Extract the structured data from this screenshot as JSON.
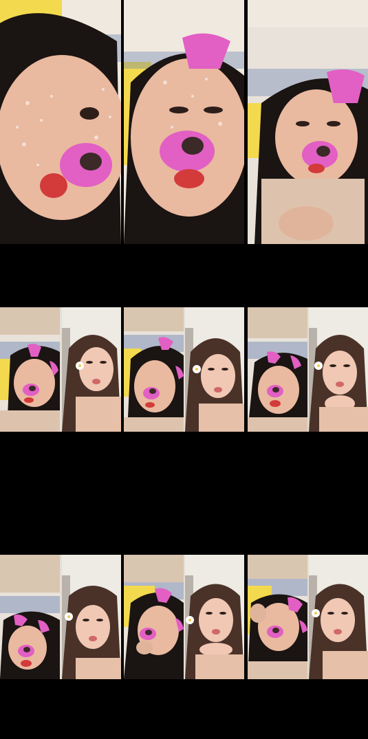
{
  "frames": {
    "row1": [
      "filtered-portrait-1",
      "filtered-portrait-2",
      "filtered-portrait-3"
    ],
    "row2": [
      "split-frame-1",
      "split-frame-2",
      "split-frame-3"
    ],
    "row3": [
      "split-frame-4",
      "split-frame-5",
      "split-frame-6"
    ]
  },
  "colors": {
    "background": "#000000",
    "skin": "#e9b9a0",
    "filter_pink": "#e25fc4",
    "nose": "#3b2a28",
    "wall": "#e8e2da",
    "bedding_yellow": "#f2d94e",
    "bedding_blue": "#5d77b0",
    "hair": "#1a1412"
  }
}
